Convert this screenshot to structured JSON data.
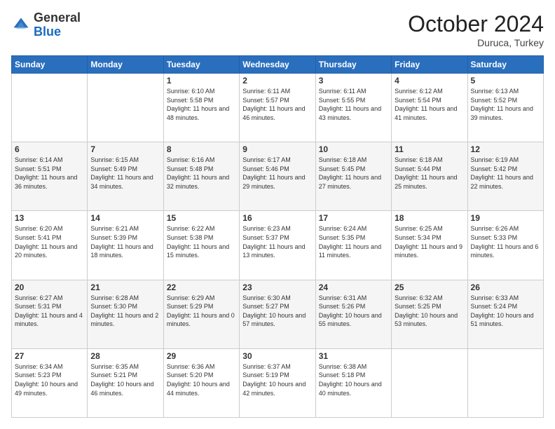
{
  "header": {
    "logo": {
      "line1": "General",
      "line2": "Blue"
    },
    "month": "October 2024",
    "location": "Duruca, Turkey"
  },
  "days_of_week": [
    "Sunday",
    "Monday",
    "Tuesday",
    "Wednesday",
    "Thursday",
    "Friday",
    "Saturday"
  ],
  "weeks": [
    [
      {
        "day": "",
        "sunrise": "",
        "sunset": "",
        "daylight": ""
      },
      {
        "day": "",
        "sunrise": "",
        "sunset": "",
        "daylight": ""
      },
      {
        "day": "1",
        "sunrise": "Sunrise: 6:10 AM",
        "sunset": "Sunset: 5:58 PM",
        "daylight": "Daylight: 11 hours and 48 minutes."
      },
      {
        "day": "2",
        "sunrise": "Sunrise: 6:11 AM",
        "sunset": "Sunset: 5:57 PM",
        "daylight": "Daylight: 11 hours and 46 minutes."
      },
      {
        "day": "3",
        "sunrise": "Sunrise: 6:11 AM",
        "sunset": "Sunset: 5:55 PM",
        "daylight": "Daylight: 11 hours and 43 minutes."
      },
      {
        "day": "4",
        "sunrise": "Sunrise: 6:12 AM",
        "sunset": "Sunset: 5:54 PM",
        "daylight": "Daylight: 11 hours and 41 minutes."
      },
      {
        "day": "5",
        "sunrise": "Sunrise: 6:13 AM",
        "sunset": "Sunset: 5:52 PM",
        "daylight": "Daylight: 11 hours and 39 minutes."
      }
    ],
    [
      {
        "day": "6",
        "sunrise": "Sunrise: 6:14 AM",
        "sunset": "Sunset: 5:51 PM",
        "daylight": "Daylight: 11 hours and 36 minutes."
      },
      {
        "day": "7",
        "sunrise": "Sunrise: 6:15 AM",
        "sunset": "Sunset: 5:49 PM",
        "daylight": "Daylight: 11 hours and 34 minutes."
      },
      {
        "day": "8",
        "sunrise": "Sunrise: 6:16 AM",
        "sunset": "Sunset: 5:48 PM",
        "daylight": "Daylight: 11 hours and 32 minutes."
      },
      {
        "day": "9",
        "sunrise": "Sunrise: 6:17 AM",
        "sunset": "Sunset: 5:46 PM",
        "daylight": "Daylight: 11 hours and 29 minutes."
      },
      {
        "day": "10",
        "sunrise": "Sunrise: 6:18 AM",
        "sunset": "Sunset: 5:45 PM",
        "daylight": "Daylight: 11 hours and 27 minutes."
      },
      {
        "day": "11",
        "sunrise": "Sunrise: 6:18 AM",
        "sunset": "Sunset: 5:44 PM",
        "daylight": "Daylight: 11 hours and 25 minutes."
      },
      {
        "day": "12",
        "sunrise": "Sunrise: 6:19 AM",
        "sunset": "Sunset: 5:42 PM",
        "daylight": "Daylight: 11 hours and 22 minutes."
      }
    ],
    [
      {
        "day": "13",
        "sunrise": "Sunrise: 6:20 AM",
        "sunset": "Sunset: 5:41 PM",
        "daylight": "Daylight: 11 hours and 20 minutes."
      },
      {
        "day": "14",
        "sunrise": "Sunrise: 6:21 AM",
        "sunset": "Sunset: 5:39 PM",
        "daylight": "Daylight: 11 hours and 18 minutes."
      },
      {
        "day": "15",
        "sunrise": "Sunrise: 6:22 AM",
        "sunset": "Sunset: 5:38 PM",
        "daylight": "Daylight: 11 hours and 15 minutes."
      },
      {
        "day": "16",
        "sunrise": "Sunrise: 6:23 AM",
        "sunset": "Sunset: 5:37 PM",
        "daylight": "Daylight: 11 hours and 13 minutes."
      },
      {
        "day": "17",
        "sunrise": "Sunrise: 6:24 AM",
        "sunset": "Sunset: 5:35 PM",
        "daylight": "Daylight: 11 hours and 11 minutes."
      },
      {
        "day": "18",
        "sunrise": "Sunrise: 6:25 AM",
        "sunset": "Sunset: 5:34 PM",
        "daylight": "Daylight: 11 hours and 9 minutes."
      },
      {
        "day": "19",
        "sunrise": "Sunrise: 6:26 AM",
        "sunset": "Sunset: 5:33 PM",
        "daylight": "Daylight: 11 hours and 6 minutes."
      }
    ],
    [
      {
        "day": "20",
        "sunrise": "Sunrise: 6:27 AM",
        "sunset": "Sunset: 5:31 PM",
        "daylight": "Daylight: 11 hours and 4 minutes."
      },
      {
        "day": "21",
        "sunrise": "Sunrise: 6:28 AM",
        "sunset": "Sunset: 5:30 PM",
        "daylight": "Daylight: 11 hours and 2 minutes."
      },
      {
        "day": "22",
        "sunrise": "Sunrise: 6:29 AM",
        "sunset": "Sunset: 5:29 PM",
        "daylight": "Daylight: 11 hours and 0 minutes."
      },
      {
        "day": "23",
        "sunrise": "Sunrise: 6:30 AM",
        "sunset": "Sunset: 5:27 PM",
        "daylight": "Daylight: 10 hours and 57 minutes."
      },
      {
        "day": "24",
        "sunrise": "Sunrise: 6:31 AM",
        "sunset": "Sunset: 5:26 PM",
        "daylight": "Daylight: 10 hours and 55 minutes."
      },
      {
        "day": "25",
        "sunrise": "Sunrise: 6:32 AM",
        "sunset": "Sunset: 5:25 PM",
        "daylight": "Daylight: 10 hours and 53 minutes."
      },
      {
        "day": "26",
        "sunrise": "Sunrise: 6:33 AM",
        "sunset": "Sunset: 5:24 PM",
        "daylight": "Daylight: 10 hours and 51 minutes."
      }
    ],
    [
      {
        "day": "27",
        "sunrise": "Sunrise: 6:34 AM",
        "sunset": "Sunset: 5:23 PM",
        "daylight": "Daylight: 10 hours and 49 minutes."
      },
      {
        "day": "28",
        "sunrise": "Sunrise: 6:35 AM",
        "sunset": "Sunset: 5:21 PM",
        "daylight": "Daylight: 10 hours and 46 minutes."
      },
      {
        "day": "29",
        "sunrise": "Sunrise: 6:36 AM",
        "sunset": "Sunset: 5:20 PM",
        "daylight": "Daylight: 10 hours and 44 minutes."
      },
      {
        "day": "30",
        "sunrise": "Sunrise: 6:37 AM",
        "sunset": "Sunset: 5:19 PM",
        "daylight": "Daylight: 10 hours and 42 minutes."
      },
      {
        "day": "31",
        "sunrise": "Sunrise: 6:38 AM",
        "sunset": "Sunset: 5:18 PM",
        "daylight": "Daylight: 10 hours and 40 minutes."
      },
      {
        "day": "",
        "sunrise": "",
        "sunset": "",
        "daylight": ""
      },
      {
        "day": "",
        "sunrise": "",
        "sunset": "",
        "daylight": ""
      }
    ]
  ]
}
